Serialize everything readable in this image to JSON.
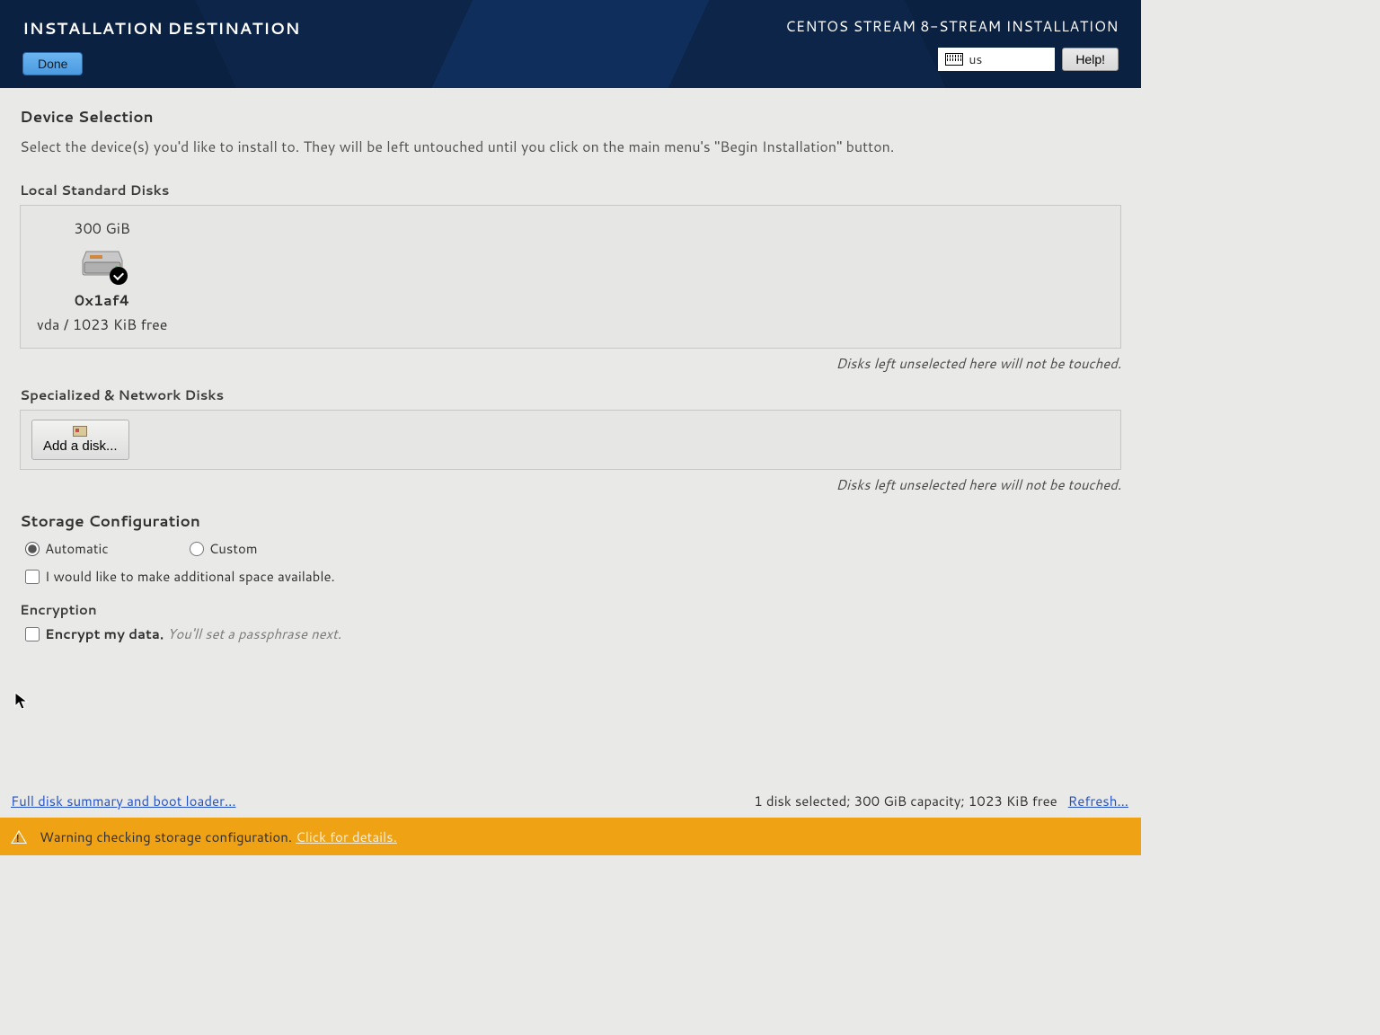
{
  "header": {
    "title": "INSTALLATION DESTINATION",
    "done_label": "Done",
    "subtitle": "CENTOS STREAM 8-STREAM INSTALLATION",
    "keyboard_layout": "us",
    "help_label": "Help!"
  },
  "device_selection": {
    "title": "Device Selection",
    "description": "Select the device(s) you'd like to install to.  They will be left untouched until you click on the main menu's \"Begin Installation\" button."
  },
  "local_disks": {
    "heading": "Local Standard Disks",
    "disk": {
      "size": "300 GiB",
      "model": "0x1af4",
      "info": "vda / 1023 KiB free"
    },
    "hint": "Disks left unselected here will not be touched."
  },
  "network_disks": {
    "heading": "Specialized & Network Disks",
    "add_label": "Add a disk...",
    "hint": "Disks left unselected here will not be touched."
  },
  "storage_config": {
    "heading": "Storage Configuration",
    "automatic_label": "Automatic",
    "custom_label": "Custom",
    "additional_space_label": "I would like to make additional space available."
  },
  "encryption": {
    "heading": "Encryption",
    "encrypt_label": "Encrypt my data.",
    "encrypt_hint": "You'll set a passphrase next."
  },
  "footer": {
    "summary_link": "Full disk summary and boot loader...",
    "status": "1 disk selected; 300 GiB capacity; 1023 KiB free",
    "refresh_link": "Refresh..."
  },
  "warning": {
    "text": "Warning checking storage configuration.",
    "details_link": "Click for details."
  }
}
